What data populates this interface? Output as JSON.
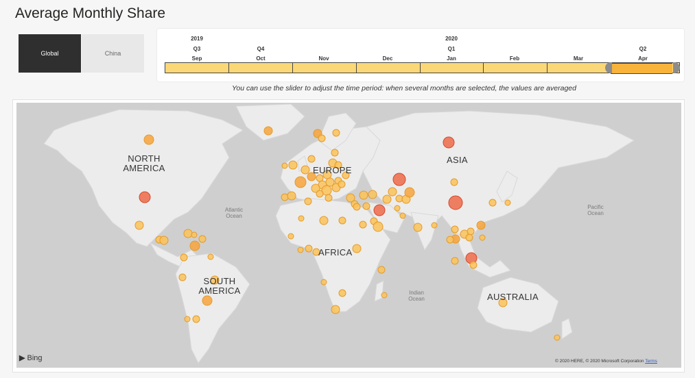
{
  "page_title": "Average Monthly Share",
  "toggle": {
    "global_label": "Global",
    "china_label": "China"
  },
  "timeline": {
    "years": [
      "2019",
      "2020"
    ],
    "quarters": [
      "Q3",
      "Q4",
      "Q1",
      "Q2"
    ],
    "months": [
      "Sep",
      "Oct",
      "Nov",
      "Dec",
      "Jan",
      "Feb",
      "Mar",
      "Apr"
    ],
    "selected_months": [
      "Apr"
    ]
  },
  "hint": "You can use the slider to adjust the time period: when several months are selected, the values are averaged",
  "map": {
    "continents": {
      "north_america_1": "NORTH",
      "north_america_2": "AMERICA",
      "europe": "EUROPE",
      "asia": "ASIA",
      "africa": "AFRICA",
      "south_america_1": "SOUTH",
      "south_america_2": "AMERICA",
      "australia": "AUSTRALIA"
    },
    "oceans": {
      "atlantic_1": "Atlantic",
      "atlantic_2": "Ocean",
      "pacific_1": "Pacific",
      "pacific_2": "Ocean",
      "indian_1": "Indian",
      "indian_2": "Ocean"
    },
    "bing_label": "Bing",
    "copyright": "© 2020 HERE, © 2020 Microsoft Corporation",
    "terms_label": "Terms",
    "colors": {
      "land": "#ececec",
      "water": "#cfcfcf",
      "bubble_high": "#ef6b4a",
      "bubble_mid": "#f8a43c",
      "bubble_low": "#fbc35a"
    }
  }
}
